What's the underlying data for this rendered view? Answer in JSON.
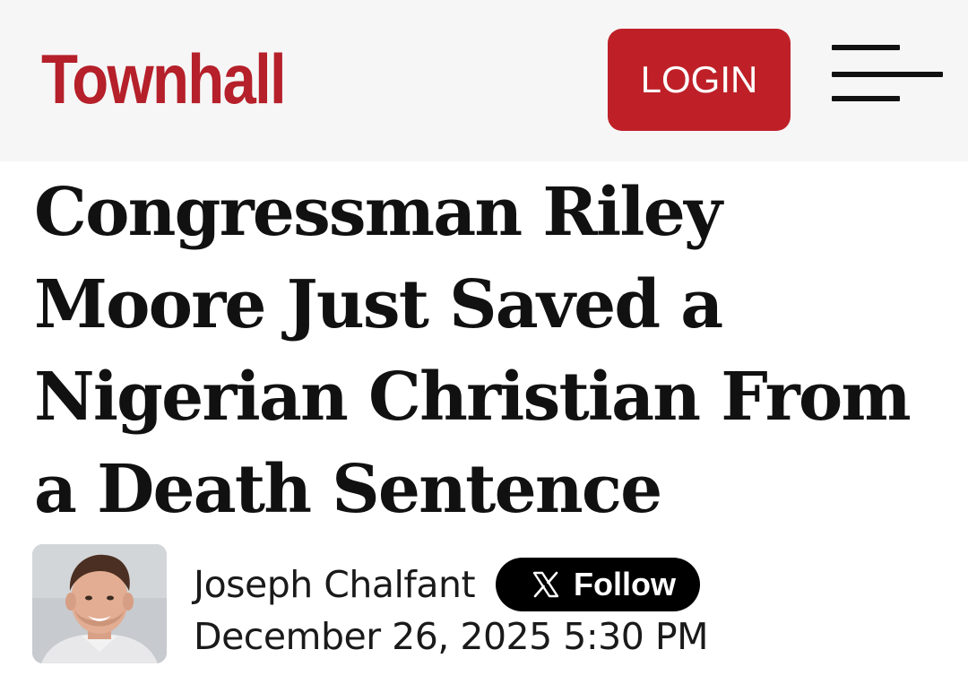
{
  "header": {
    "logo_text": "Townhall",
    "login_label": "LOGIN",
    "menu_icon": "hamburger-menu-icon",
    "brand_color": "#bf2028"
  },
  "article": {
    "headline": "Congressman Riley Moore Just Saved a Nigerian Christian From a Death Sentence",
    "author": {
      "name": "Joseph Chalfant",
      "follow_label": "Follow",
      "follow_icon": "x-logo-icon"
    },
    "date": "December 26, 2025 5:30 PM"
  }
}
